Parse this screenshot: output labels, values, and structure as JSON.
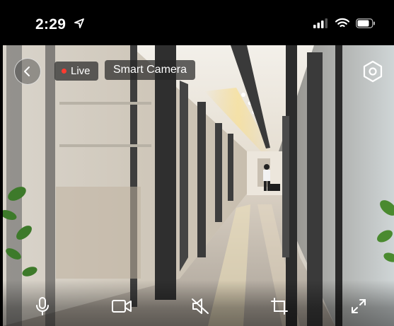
{
  "status_bar": {
    "time": "2:29"
  },
  "overlay": {
    "live_label": "Live",
    "camera_name": "Smart Camera"
  },
  "icons": {
    "location": "location-arrow-icon",
    "signal": "cellular-signal-icon",
    "wifi": "wifi-icon",
    "battery": "battery-icon",
    "back": "chevron-left-icon",
    "settings": "hexagon-settings-icon",
    "mic": "microphone-icon",
    "record": "video-record-icon",
    "mute": "speaker-muted-icon",
    "screenshot": "crop-icon",
    "fullscreen": "expand-icon"
  },
  "colors": {
    "live_dot": "#ff3b30",
    "overlay_bg": "#282828"
  }
}
